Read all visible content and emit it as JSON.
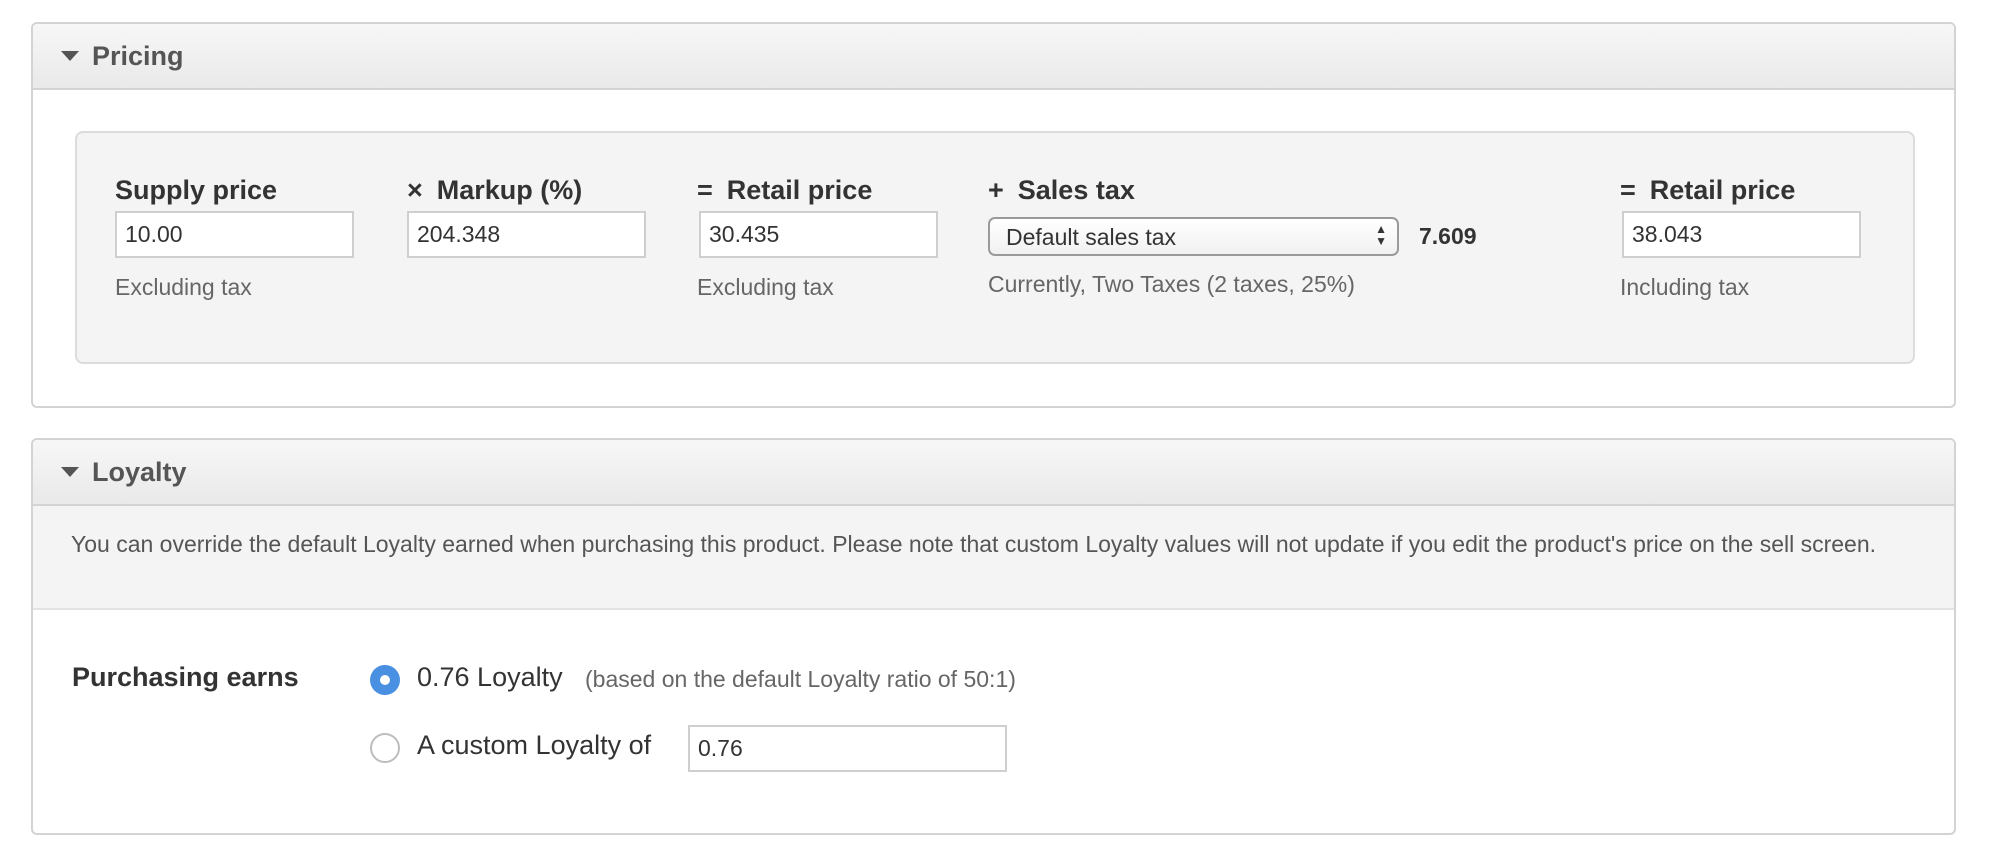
{
  "pricing": {
    "title": "Pricing",
    "supply_price": {
      "label": "Supply price",
      "value": "10.00",
      "note": "Excluding tax"
    },
    "markup": {
      "op": "×",
      "label": "Markup (%)",
      "value": "204.348"
    },
    "retail_excl": {
      "op": "=",
      "label": "Retail price",
      "value": "30.435",
      "note": "Excluding tax"
    },
    "sales_tax": {
      "op": "+",
      "label": "Sales tax",
      "selected": "Default sales tax",
      "amount": "7.609",
      "note": "Currently, Two Taxes (2 taxes, 25%)"
    },
    "retail_incl": {
      "op": "=",
      "label": "Retail price",
      "value": "38.043",
      "note": "Including tax"
    }
  },
  "loyalty": {
    "title": "Loyalty",
    "note": "You can override the default Loyalty earned when purchasing this product. Please note that custom Loyalty values will not update if you edit the product's price on the sell screen.",
    "earns_label": "Purchasing earns",
    "default_option": {
      "label": "0.76 Loyalty",
      "hint": "(based on the default Loyalty ratio of 50:1)",
      "selected": true
    },
    "custom_option": {
      "label": "A custom Loyalty of",
      "value": "0.76",
      "selected": false
    }
  },
  "colors": {
    "accent": "#4a90e2",
    "panel_border": "#d3d3d3",
    "box_background": "#f4f4f4"
  }
}
